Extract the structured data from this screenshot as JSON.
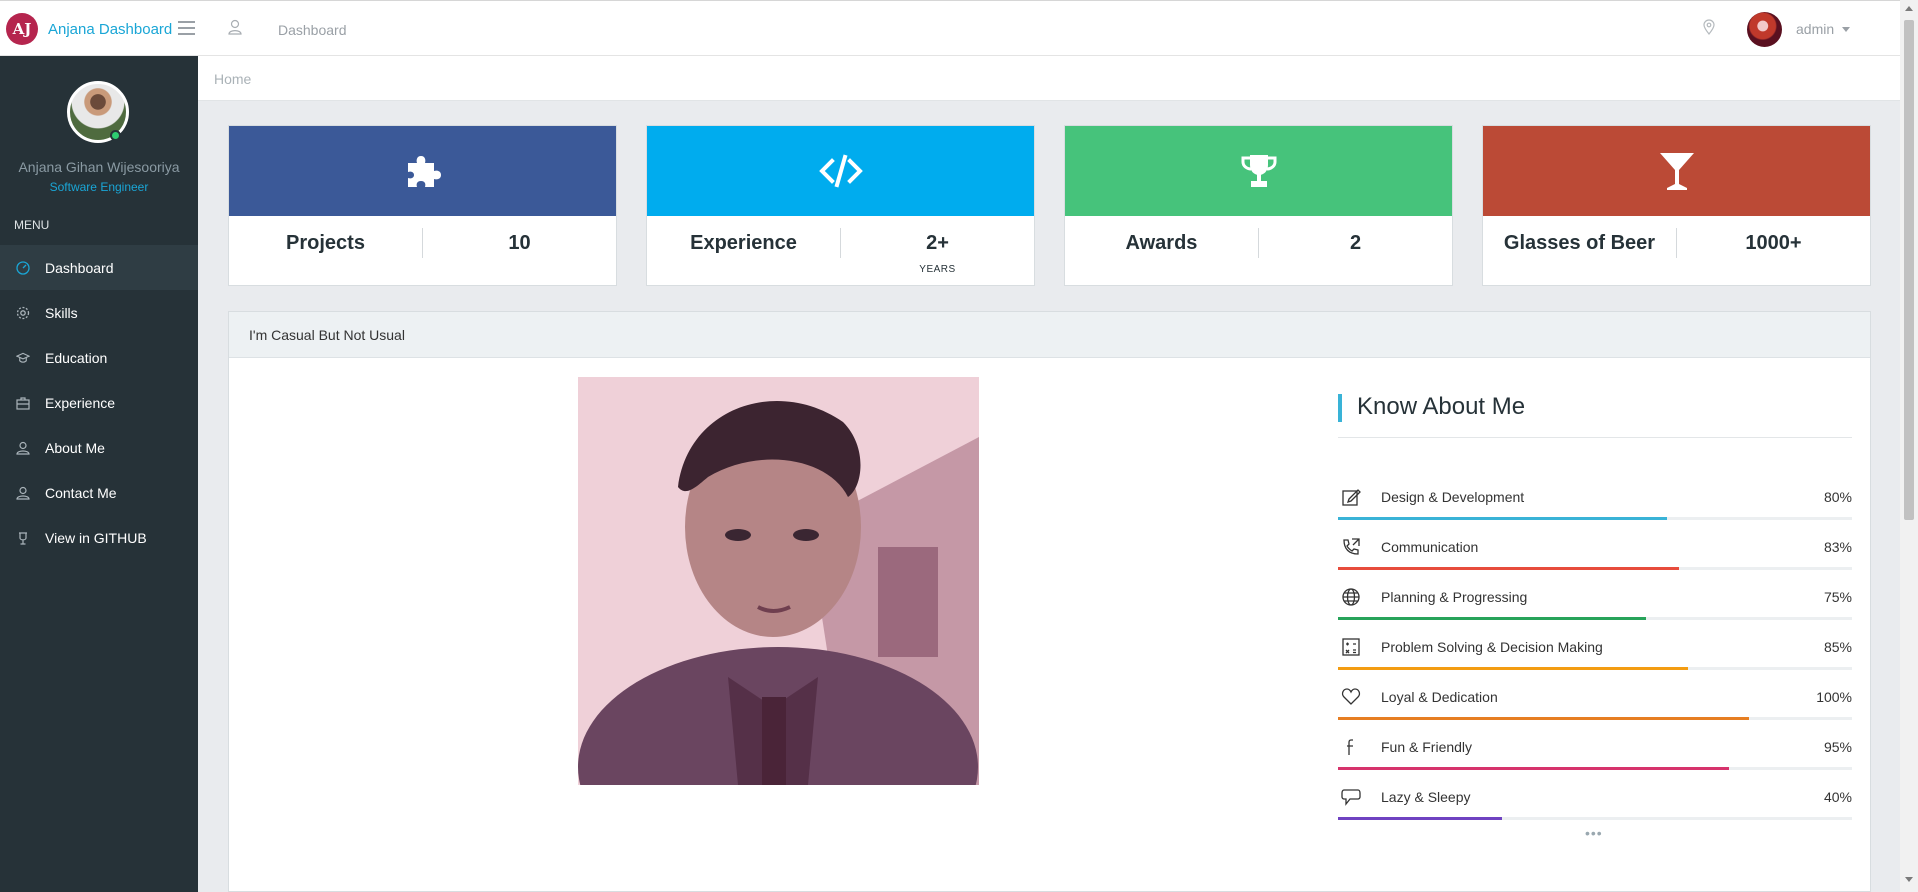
{
  "header": {
    "logo_text": "AJ",
    "brand": "Anjana Dashboard",
    "page_title": "Dashboard",
    "user": "admin"
  },
  "sidebar": {
    "profile_name": "Anjana Gihan Wijesooriya",
    "profile_role": "Software Engineer",
    "menu_label": "MENU",
    "items": [
      {
        "label": "Dashboard",
        "icon": "gauge-icon",
        "active": true
      },
      {
        "label": "Skills",
        "icon": "gear-icon",
        "active": false
      },
      {
        "label": "Education",
        "icon": "graduation-cap-icon",
        "active": false
      },
      {
        "label": "Experience",
        "icon": "briefcase-icon",
        "active": false
      },
      {
        "label": "About Me",
        "icon": "user-icon",
        "active": false
      },
      {
        "label": "Contact Me",
        "icon": "user-icon",
        "active": false
      },
      {
        "label": "View in GITHUB",
        "icon": "github-icon",
        "active": false
      }
    ]
  },
  "breadcrumb": {
    "home": "Home"
  },
  "cards": [
    {
      "label": "Projects",
      "value": "10",
      "unit": "",
      "icon": "puzzle-icon",
      "color": "#3b5998"
    },
    {
      "label": "Experience",
      "value": "2+",
      "unit": "YEARS",
      "icon": "code-icon",
      "color": "#00acee"
    },
    {
      "label": "Awards",
      "value": "2",
      "unit": "",
      "icon": "trophy-icon",
      "color": "#46c37b"
    },
    {
      "label": "Glasses of Beer",
      "value": "1000+",
      "unit": "",
      "icon": "glass-icon",
      "color": "#bb4a36"
    }
  ],
  "panel": {
    "title": "I'm Casual But Not Usual",
    "know_title": "Know About Me",
    "more": "•••"
  },
  "skills": [
    {
      "name": "Design & Development",
      "percent_label": "80%",
      "value": 80,
      "color": "#39b3d7",
      "icon": "edit-icon"
    },
    {
      "name": "Communication",
      "percent_label": "83%",
      "value": 83,
      "color": "#e74c3c",
      "icon": "phone-icon"
    },
    {
      "name": "Planning & Progressing",
      "percent_label": "75%",
      "value": 75,
      "color": "#27a35a",
      "icon": "globe-icon"
    },
    {
      "name": "Problem Solving & Decision Making",
      "percent_label": "85%",
      "value": 85,
      "color": "#f39c12",
      "icon": "calculator-icon"
    },
    {
      "name": "Loyal & Dedication",
      "percent_label": "100%",
      "value": 100,
      "color": "#e67e22",
      "icon": "heart-icon"
    },
    {
      "name": "Fun & Friendly",
      "percent_label": "95%",
      "value": 95,
      "color": "#d6336c",
      "icon": "facebook-icon"
    },
    {
      "name": "Lazy & Sleepy",
      "percent_label": "40%",
      "value": 40,
      "color": "#6f42c1",
      "icon": "comment-icon"
    }
  ]
}
